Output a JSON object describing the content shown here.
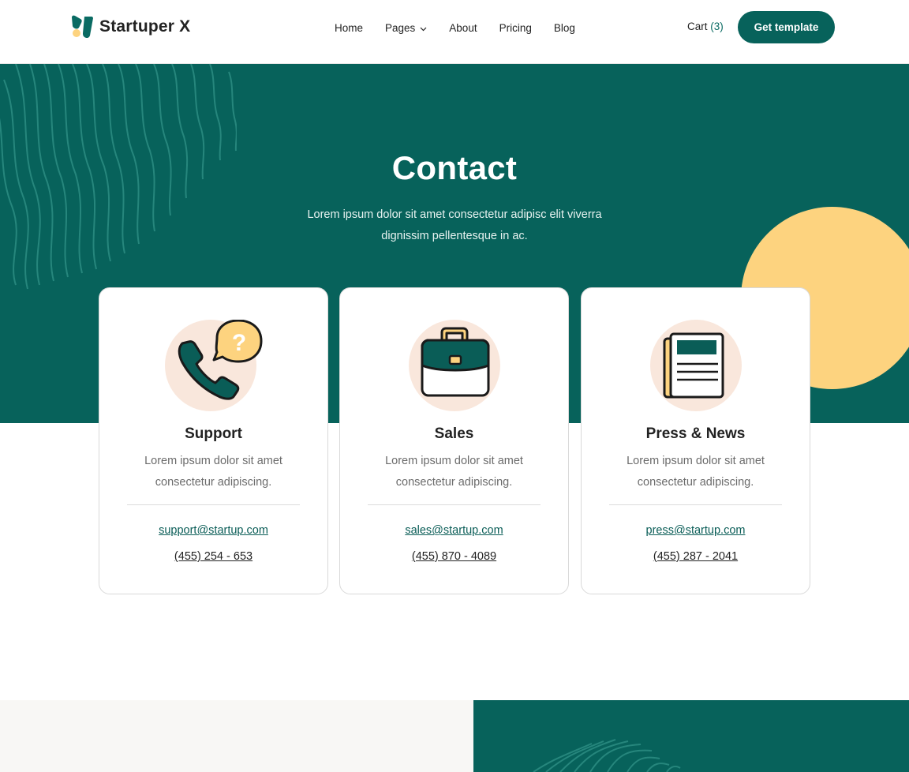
{
  "header": {
    "brand": "Startuper X",
    "nav": [
      {
        "label": "Home"
      },
      {
        "label": "Pages"
      },
      {
        "label": "About"
      },
      {
        "label": "Pricing"
      },
      {
        "label": "Blog"
      }
    ],
    "cart_label": "Cart",
    "cart_count": "(3)",
    "cta_label": "Get template"
  },
  "hero": {
    "title": "Contact",
    "subtitle": "Lorem ipsum dolor sit amet consectetur adipisc elit viverra dignissim pellentesque in ac."
  },
  "cards": [
    {
      "icon": "phone-question-icon",
      "title": "Support",
      "description": "Lorem ipsum dolor sit amet consectetur adipiscing.",
      "email": "support@startup.com",
      "phone": "(455) 254 - 653"
    },
    {
      "icon": "briefcase-icon",
      "title": "Sales",
      "description": "Lorem ipsum dolor sit amet consectetur adipiscing.",
      "email": "sales@startup.com",
      "phone": "(455) 870 - 4089"
    },
    {
      "icon": "newspaper-icon",
      "title": "Press & News",
      "description": "Lorem ipsum dolor sit amet consectetur adipiscing.",
      "email": "press@startup.com",
      "phone": "(455) 287 - 2041"
    }
  ],
  "colors": {
    "primary": "#07625b",
    "accent": "#fdd37f",
    "icon_bg": "#f9e7dc",
    "bottom_left_bg": "#f8f7f5"
  }
}
